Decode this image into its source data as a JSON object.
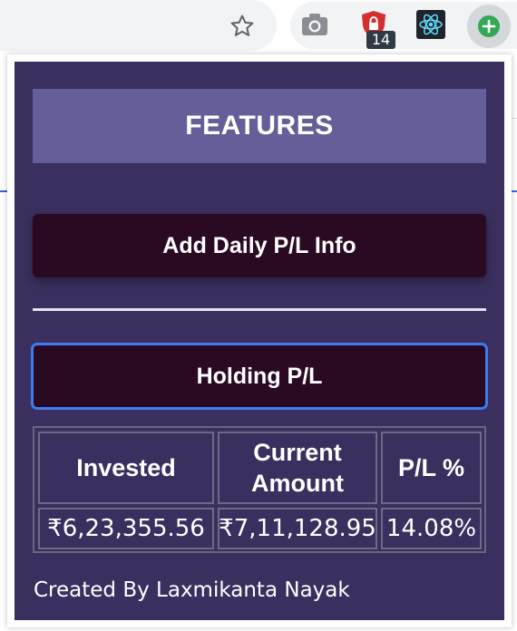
{
  "browser": {
    "icons": [
      "star-icon",
      "camera-icon",
      "shield-icon",
      "react-icon",
      "plus-icon"
    ],
    "shield_badge": "14",
    "colors": {
      "shield": "#d32f2f",
      "plus": "#34a853",
      "react": "#61dafb"
    }
  },
  "popup": {
    "header": "FEATURES",
    "add_daily_button": "Add Daily P/L Info",
    "holding_button": "Holding P/L",
    "table": {
      "headers": [
        "Invested",
        "Current Amount",
        "P/L %"
      ],
      "row": [
        "₹6,23,355.56",
        "₹7,11,128.95",
        "14.08%"
      ]
    },
    "credit": "Created By Laxmikanta Nayak",
    "colors": {
      "background": "#3a2f5e",
      "header": "#655f99",
      "button": "#2a0a22",
      "focus_ring": "#3e7bf0"
    }
  }
}
